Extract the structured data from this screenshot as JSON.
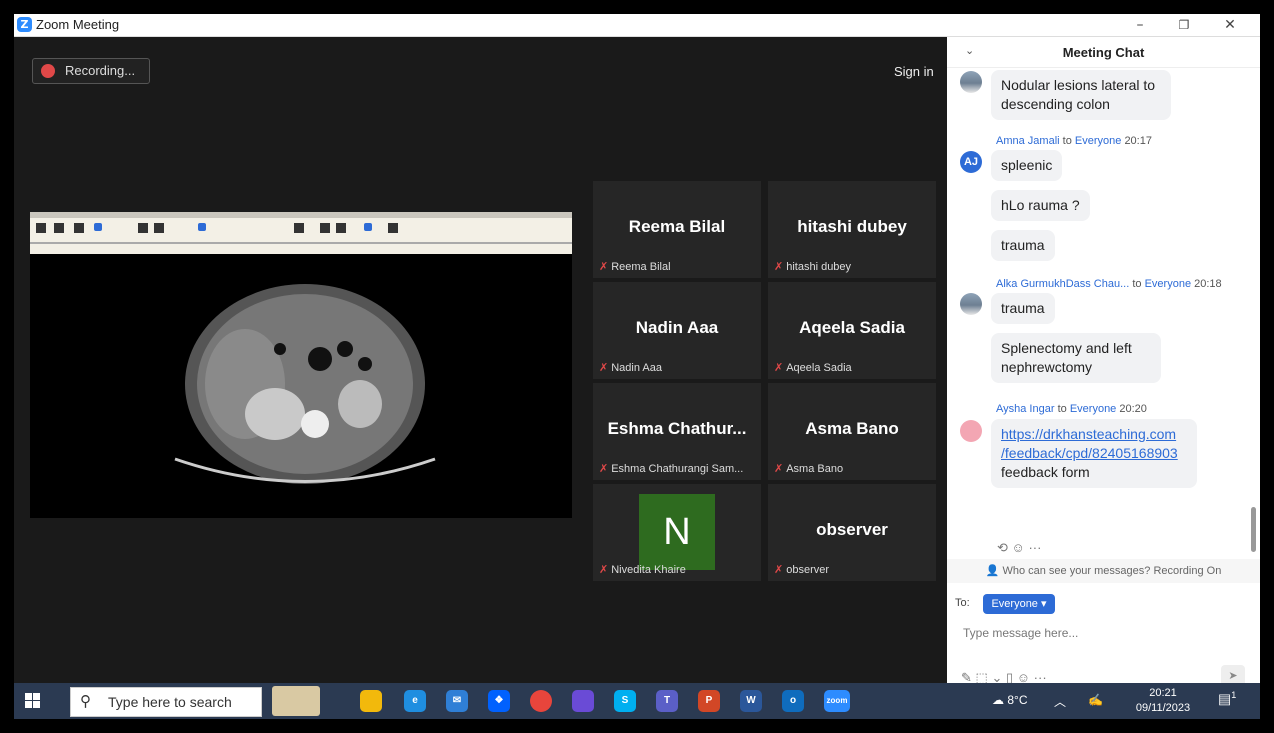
{
  "window": {
    "title": "Zoom Meeting",
    "minimize": "–",
    "restore": "❐",
    "close": "✕"
  },
  "stage": {
    "recording_label": "Recording...",
    "sign_in": "Sign in"
  },
  "tiles": [
    {
      "name": "Reema Bilal",
      "sub": "Reema Bilal"
    },
    {
      "name": "hitashi dubey",
      "sub": "hitashi dubey"
    },
    {
      "name": "Nadin Aaa",
      "sub": "Nadin Aaa"
    },
    {
      "name": "Aqeela Sadia",
      "sub": "Aqeela Sadia"
    },
    {
      "name": "Eshma  Chathur...",
      "sub": "Eshma Chathurangi Sam..."
    },
    {
      "name": "Asma Bano",
      "sub": "Asma Bano"
    },
    {
      "name": "",
      "avatar_letter": "N",
      "sub": "Nivedita Khaire"
    },
    {
      "name": "observer",
      "sub": "observer"
    }
  ],
  "chat": {
    "title": "Meeting Chat",
    "messages": [
      {
        "text": "Nodular lesions lateral to descending colon"
      },
      {
        "sender": "Amna Jamali",
        "to": "to",
        "target": "Everyone",
        "time": "20:17",
        "initials": "AJ",
        "text": "spleenic"
      },
      {
        "text": "hLo rauma ?"
      },
      {
        "text": "trauma"
      },
      {
        "sender": "Alka GurmukhDass Chau...",
        "to": "to",
        "target": "Everyone",
        "time": "20:18",
        "text": "trauma"
      },
      {
        "text": "Splenectomy and left nephrewctomy"
      },
      {
        "sender": "Aysha Ingar",
        "to": "to",
        "target": "Everyone",
        "time": "20:20",
        "link_1": "https://drkhansteaching.com",
        "link_2": "/feedback/cpd/82405168903",
        "text": "feedback form"
      }
    ],
    "visibility_notice": "Who can see your messages? Recording On",
    "to_label": "To:",
    "recipient": "Everyone",
    "input_placeholder": "Type message here..."
  },
  "taskbar": {
    "search_placeholder": "Type here to search",
    "temperature": "8°C",
    "time": "20:21",
    "date": "09/11/2023",
    "notification_count": "1",
    "apps": [
      {
        "label": "",
        "color": "#f2b90c"
      },
      {
        "label": "e",
        "color": "#1f8ee0"
      },
      {
        "label": "✉",
        "color": "#2f7fd6"
      },
      {
        "label": "❖",
        "color": "#0061fe"
      },
      {
        "label": "",
        "color": "#e8453c"
      },
      {
        "label": "",
        "color": "#6a4bd6"
      },
      {
        "label": "S",
        "color": "#00aff0"
      },
      {
        "label": "T",
        "color": "#5b5fc7"
      },
      {
        "label": "P",
        "color": "#d24726"
      },
      {
        "label": "W",
        "color": "#2b579a"
      },
      {
        "label": "o",
        "color": "#0f6cbd"
      },
      {
        "label": "zoom",
        "color": "#2d8cff"
      }
    ]
  }
}
